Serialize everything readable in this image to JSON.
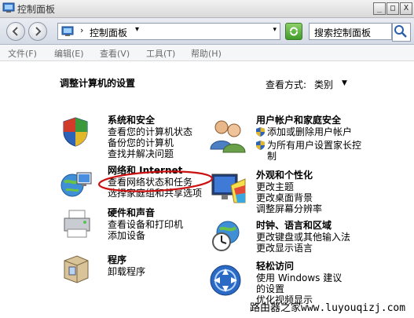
{
  "window": {
    "title": "控制面板"
  },
  "window_buttons": {
    "minimize": "_",
    "maximize": "□",
    "close": "X"
  },
  "address": {
    "crumb": "控制面板",
    "separator": "›",
    "dropdown": "▾"
  },
  "search": {
    "placeholder": "搜索控制面板"
  },
  "menu": [
    {
      "label": "文件(F)"
    },
    {
      "label": "编辑(E)"
    },
    {
      "label": "查看(V)"
    },
    {
      "label": "工具(T)"
    },
    {
      "label": "帮助(H)"
    }
  ],
  "content": {
    "heading": "调整计算机的设置",
    "view_by_label": "查看方式:",
    "view_by_value": "类别",
    "view_by_dropdown": "▼"
  },
  "categories": {
    "security": {
      "title": "系统和安全",
      "links": [
        "查看您的计算机状态",
        "备份您的计算机",
        "查找并解决问题"
      ]
    },
    "network": {
      "title": "网络和 Internet",
      "links": [
        "查看网络状态和任务",
        "选择家庭组和共享选项"
      ]
    },
    "hardware": {
      "title": "硬件和声音",
      "links": [
        "查看设备和打印机",
        "添加设备"
      ]
    },
    "programs": {
      "title": "程序",
      "links": [
        "卸载程序"
      ]
    },
    "users": {
      "title": "用户帐户和家庭安全",
      "links": [
        "添加或删除用户帐户",
        "为所有用户设置家长控制"
      ]
    },
    "appearance": {
      "title": "外观和个性化",
      "links": [
        "更改主题",
        "更改桌面背景",
        "调整屏幕分辨率"
      ]
    },
    "clock": {
      "title": "时钟、语言和区域",
      "links": [
        "更改键盘或其他输入法",
        "更改显示语言"
      ]
    },
    "ease": {
      "title": "轻松访问",
      "links": [
        "使用 Windows 建议的设置",
        "优化视频显示"
      ]
    }
  },
  "watermark": "路由器之家www.luyouqizj.com",
  "colors": {
    "annotation": "#cc1111",
    "link": "#000000"
  }
}
